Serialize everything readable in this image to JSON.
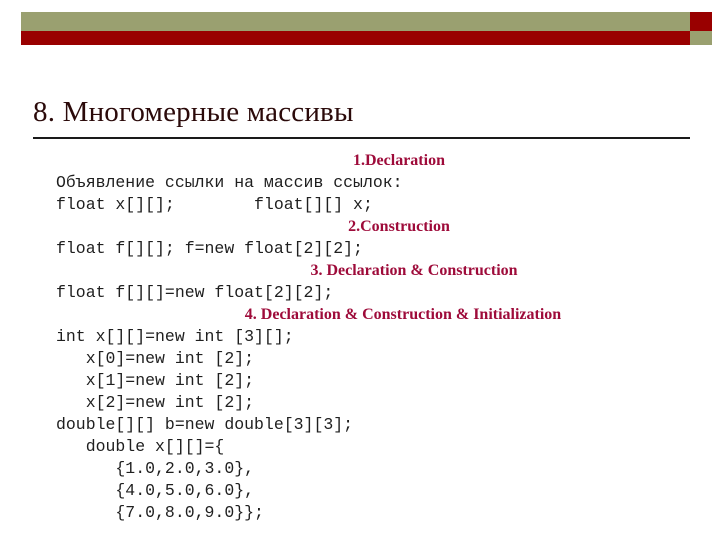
{
  "slide": {
    "title": "8. Многомерные массивы",
    "decor": {
      "olive": "#9aa070",
      "dark_red": "#990000",
      "title_color": "#2b0a0a",
      "heading_color": "#9e0b3a",
      "code_color": "#1f1f1f"
    }
  },
  "content": {
    "lines": [
      {
        "kind": "heading",
        "text": "1.Declaration",
        "indent": 2
      },
      {
        "kind": "code",
        "text": "Объявление ссылки на массив ссылок:"
      },
      {
        "kind": "code",
        "text": "float x[][];        float[][] x;"
      },
      {
        "kind": "heading",
        "text": "2.Construction",
        "indent": 2
      },
      {
        "kind": "code",
        "text": "float f[][]; f=new float[2][2];"
      },
      {
        "kind": "heading",
        "text": "3. Declaration & Construction",
        "indent": 3
      },
      {
        "kind": "code",
        "text": "float f[][]=new float[2][2];"
      },
      {
        "kind": "heading",
        "text": "4. Declaration & Construction & Initialization",
        "indent": 4
      },
      {
        "kind": "code",
        "text": "int x[][]=new int [3][];"
      },
      {
        "kind": "code",
        "text": "   x[0]=new int [2];"
      },
      {
        "kind": "code",
        "text": "   x[1]=new int [2];"
      },
      {
        "kind": "code",
        "text": "   x[2]=new int [2];"
      },
      {
        "kind": "code",
        "text": "double[][] b=new double[3][3];"
      },
      {
        "kind": "code",
        "text": "   double x[][]={"
      },
      {
        "kind": "code",
        "text": "      {1.0,2.0,3.0},"
      },
      {
        "kind": "code",
        "text": "      {4.0,5.0,6.0},"
      },
      {
        "kind": "code",
        "text": "      {7.0,8.0,9.0}};"
      }
    ]
  }
}
